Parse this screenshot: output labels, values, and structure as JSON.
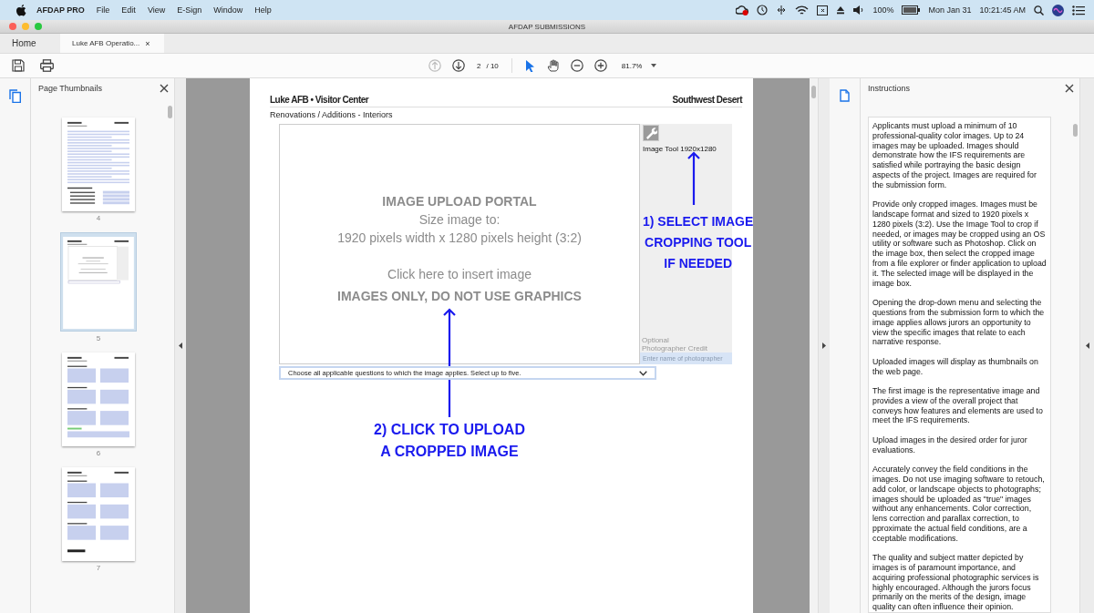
{
  "menu_bar": {
    "app_name": "AFDAP PRO",
    "menus": [
      "File",
      "Edit",
      "View",
      "E-Sign",
      "Window",
      "Help"
    ],
    "battery": "100%",
    "date": "Mon Jan 31",
    "time": "10:21:45 AM"
  },
  "window": {
    "title": "AFDAP SUBMISSIONS"
  },
  "tabs": [
    {
      "label": "Home",
      "selected": false
    },
    {
      "label": "Luke AFB Operatio...",
      "selected": true,
      "close": "×"
    }
  ],
  "toolbar": {
    "page": "2",
    "page_count": "/ 10",
    "zoom": "81.7%",
    "tools": [
      {
        "kind": "pointer",
        "selected": true
      },
      {
        "kind": "hand",
        "selected": false
      },
      {
        "kind": "zoom-out",
        "selected": false
      },
      {
        "kind": "zoom-in",
        "selected": false
      }
    ],
    "prev_disabled": true
  },
  "thumbnails_panel": {
    "title": "Page Thumbnails",
    "pages": [
      {
        "label": "4",
        "selected": false
      },
      {
        "label": "5",
        "selected": true
      },
      {
        "label": "6",
        "selected": false
      },
      {
        "label": "7",
        "selected": false
      }
    ]
  },
  "document": {
    "title": "Luke AFB • Visitor Center",
    "region": "Southwest Desert",
    "subtitle": "Renovations / Additions - Interiors",
    "image_box": {
      "heading": "IMAGE UPLOAD PORTAL",
      "size_label": "Size image to:",
      "size": "1920 pixels width x 1280 pixels height (3:2)",
      "prompt": "Click here to insert image",
      "warning": "IMAGES ONLY, DO NOT USE GRAPHICS"
    },
    "image_tool": "Image Tool 1920x1280",
    "credit_label": [
      "Optional",
      "Photographer Credit"
    ],
    "credit_field": {
      "placeholder": "Enter name of photographer"
    },
    "questions_dropdown": "Choose all applicable questions to which the image applies. Select up to five.",
    "annotations": [
      {
        "lines": [
          "1) SELECT IMAGE",
          "CROPPING TOOL",
          "IF NEEDED"
        ]
      },
      {
        "lines": [
          "2) CLICK TO UPLOAD",
          "A CROPPED IMAGE"
        ]
      }
    ]
  },
  "instructions_panel": {
    "title": "Instructions",
    "paragraphs": [
      "Applicants must upload a minimum of 10 professional-quality color images. Up to 24 images may be uploaded. Images should demonstrate how the IFS requirements are satisfied while portraying the basic design aspects of the project. Images are required for the submission form.",
      "Provide only cropped images. Images must be landscape format and sized to 1920 pixels x 1280 pixels (3:2). Use the Image Tool to crop if needed, or images may be cropped using an OS utility or software such as Photoshop. Click on the image box, then select the cropped image from a file explorer or finder application to upload it. The selected image will be displayed in the image box.",
      "Opening the drop-down menu and selecting the questions from the submission form to which the image applies allows jurors an opportunity to view the specific images that relate to each narrative response.",
      "Uploaded images will display as thumbnails on the web page.",
      "The first image is the representative image and provides a view of the overall project that conveys how features and elements are used to meet the IFS requirements.",
      "Upload images in the desired order for juror evaluations.",
      "Accurately convey the field conditions in the images. Do not use imaging software to retouch, add color, or landscape objects to photographs; images should be uploaded as \"true\" images without any enhancements. Color correction, lens correction and parallax correction, to pproximate the actual field conditions, are a cceptable modifications.",
      "The quality and subject matter depicted by images is of paramount importance, and acquiring professional photographic services is highly encouraged. Although the jurors focus primarily on the merits of the design, image quality can often influence their opinion."
    ]
  }
}
